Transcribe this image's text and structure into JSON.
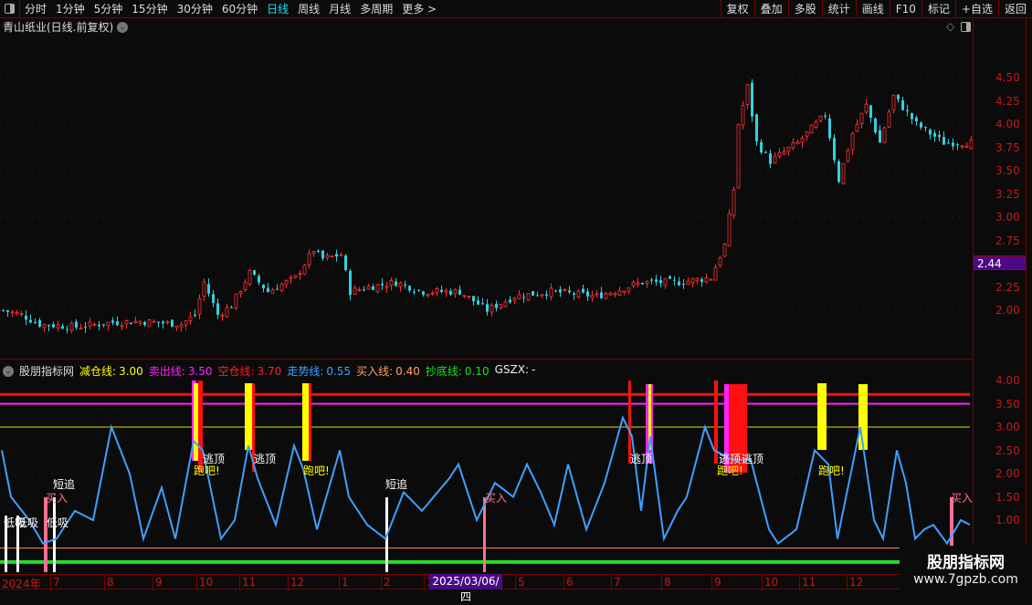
{
  "toolbar": {
    "periods": [
      "分时",
      "1分钟",
      "5分钟",
      "15分钟",
      "30分钟",
      "60分钟",
      "日线",
      "周线",
      "月线",
      "多周期",
      "更多 >"
    ],
    "active": "日线",
    "right_buttons": [
      "复权",
      "叠加",
      "多股",
      "统计",
      "画线",
      "F10",
      "标记",
      "+自选",
      "返回"
    ]
  },
  "title": "青山纸业(日线.前复权)",
  "price_axis": [
    "4.50",
    "4.25",
    "4.00",
    "3.75",
    "3.50",
    "3.25",
    "3.00",
    "2.75",
    "2.25",
    "2.00"
  ],
  "current_price": "2.44",
  "indicator": {
    "name": "股朋指标网",
    "params": [
      {
        "label": "减仓线:",
        "value": "3.00",
        "color": "#ffff00"
      },
      {
        "label": "卖出线:",
        "value": "3.50",
        "color": "#ff22ff"
      },
      {
        "label": "空仓线:",
        "value": "3.70",
        "color": "#ff2020"
      },
      {
        "label": "走势线:",
        "value": "0.55",
        "color": "#3fa0ff"
      },
      {
        "label": "买入线:",
        "value": "0.40",
        "color": "#ffa060"
      },
      {
        "label": "抄底线:",
        "value": "0.10",
        "color": "#22dd22"
      },
      {
        "label": "GSZX:",
        "value": "-",
        "color": "#eeeeee"
      }
    ],
    "axis": [
      "4.00",
      "3.50",
      "3.00",
      "2.50",
      "2.00",
      "1.50",
      "1.00"
    ]
  },
  "signals": {
    "dixi": "低吸",
    "duanzhui": "短追",
    "mairu": "买入",
    "taoding": "逃顶",
    "paoba": "跑吧!"
  },
  "dates": {
    "year": "2024年",
    "months": [
      "7",
      "8",
      "9",
      "10",
      "11",
      "12",
      "1",
      "2",
      "3",
      "5",
      "6",
      "7",
      "8",
      "9",
      "10",
      "11",
      "12"
    ],
    "cursor": "2025/03/06/四"
  },
  "watermark": {
    "name": "股朋指标网",
    "url": "www.7gpzb.com"
  },
  "colors": {
    "up": "#ff3030",
    "down": "#30d0e0",
    "trend": "#3fa0ff"
  },
  "chart_data": {
    "type": "candlestick",
    "bars": 213,
    "price_keys": [
      [
        0,
        2.0
      ],
      [
        4,
        1.95
      ],
      [
        8,
        1.85
      ],
      [
        16,
        1.82
      ],
      [
        24,
        1.87
      ],
      [
        30,
        1.88
      ],
      [
        39,
        1.85
      ],
      [
        42,
        1.95
      ],
      [
        44,
        2.3
      ],
      [
        47,
        1.95
      ],
      [
        50,
        2.05
      ],
      [
        54,
        2.4
      ],
      [
        58,
        2.2
      ],
      [
        64,
        2.35
      ],
      [
        68,
        2.65
      ],
      [
        70,
        2.55
      ],
      [
        74,
        2.6
      ],
      [
        76,
        2.2
      ],
      [
        80,
        2.25
      ],
      [
        86,
        2.3
      ],
      [
        92,
        2.2
      ],
      [
        100,
        2.2
      ],
      [
        106,
        2.0
      ],
      [
        112,
        2.15
      ],
      [
        120,
        2.2
      ],
      [
        130,
        2.15
      ],
      [
        140,
        2.3
      ],
      [
        148,
        2.3
      ],
      [
        155,
        2.35
      ],
      [
        158,
        2.7
      ],
      [
        160,
        3.3
      ],
      [
        161,
        4.0
      ],
      [
        163,
        4.4
      ],
      [
        165,
        3.8
      ],
      [
        168,
        3.6
      ],
      [
        174,
        3.8
      ],
      [
        180,
        4.1
      ],
      [
        183,
        3.4
      ],
      [
        186,
        3.9
      ],
      [
        189,
        4.2
      ],
      [
        192,
        3.8
      ],
      [
        195,
        4.3
      ],
      [
        200,
        4.0
      ],
      [
        206,
        3.8
      ],
      [
        212,
        3.8
      ]
    ],
    "trend_keys": [
      [
        0,
        2.5
      ],
      [
        2,
        1.5
      ],
      [
        6,
        1.0
      ],
      [
        9,
        0.5
      ],
      [
        12,
        0.6
      ],
      [
        16,
        1.2
      ],
      [
        20,
        1.0
      ],
      [
        24,
        3.0
      ],
      [
        28,
        2.0
      ],
      [
        31,
        0.6
      ],
      [
        35,
        1.7
      ],
      [
        38,
        0.6
      ],
      [
        42,
        2.7
      ],
      [
        44,
        2.5
      ],
      [
        48,
        0.6
      ],
      [
        51,
        1.0
      ],
      [
        54,
        2.6
      ],
      [
        56,
        1.9
      ],
      [
        60,
        0.9
      ],
      [
        64,
        2.6
      ],
      [
        66,
        2.1
      ],
      [
        69,
        0.8
      ],
      [
        74,
        2.5
      ],
      [
        76,
        1.5
      ],
      [
        80,
        0.9
      ],
      [
        84,
        0.6
      ],
      [
        88,
        1.6
      ],
      [
        92,
        1.2
      ],
      [
        98,
        1.9
      ],
      [
        100,
        2.2
      ],
      [
        104,
        1.0
      ],
      [
        108,
        1.8
      ],
      [
        112,
        1.5
      ],
      [
        115,
        2.2
      ],
      [
        118,
        1.6
      ],
      [
        121,
        0.9
      ],
      [
        124,
        2.2
      ],
      [
        128,
        0.8
      ],
      [
        132,
        1.8
      ],
      [
        136,
        3.2
      ],
      [
        138,
        2.8
      ],
      [
        140,
        1.2
      ],
      [
        142,
        2.8
      ],
      [
        145,
        0.6
      ],
      [
        148,
        1.2
      ],
      [
        150,
        1.5
      ],
      [
        154,
        3.0
      ],
      [
        156,
        2.5
      ],
      [
        160,
        2.3
      ],
      [
        164,
        2.3
      ],
      [
        168,
        0.8
      ],
      [
        170,
        0.5
      ],
      [
        174,
        0.8
      ],
      [
        178,
        2.5
      ],
      [
        181,
        2.2
      ],
      [
        183,
        0.6
      ],
      [
        188,
        3.0
      ],
      [
        191,
        1.0
      ],
      [
        193,
        0.6
      ],
      [
        196,
        2.5
      ],
      [
        198,
        1.8
      ],
      [
        200,
        0.6
      ],
      [
        202,
        0.8
      ],
      [
        204,
        0.9
      ],
      [
        207,
        0.5
      ],
      [
        210,
        1.0
      ],
      [
        212,
        0.9
      ]
    ],
    "levels": [
      3.7,
      3.5,
      3.0,
      0.4,
      0.1
    ]
  }
}
